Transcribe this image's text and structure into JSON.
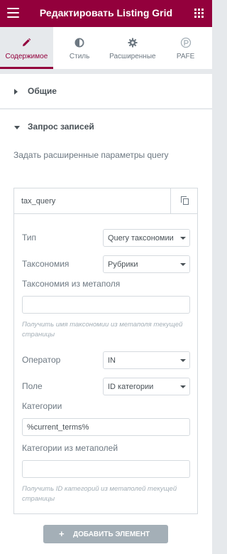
{
  "header": {
    "title": "Редактировать Listing Grid",
    "menu_icon": "hamburger-icon",
    "grid_icon": "apps-grid-icon",
    "bg_color": "#93003c"
  },
  "tabs": [
    {
      "label": "Содержимое",
      "icon": "pencil-icon",
      "active": true
    },
    {
      "label": "Стиль",
      "icon": "half-circle-icon",
      "active": false
    },
    {
      "label": "Расширенные",
      "icon": "gear-icon",
      "active": false
    },
    {
      "label": "PAFE",
      "icon": "pafe-logo-icon",
      "active": false
    }
  ],
  "sections": {
    "general": {
      "label": "Общие",
      "expanded": false
    },
    "query": {
      "label": "Запрос записей",
      "expanded": true
    }
  },
  "query": {
    "description": "Задать расширенные параметры query",
    "item": {
      "title": "tax_query",
      "type": {
        "label": "Тип",
        "value": "Query таксономии"
      },
      "taxonomy": {
        "label": "Таксономия",
        "value": "Рубрики"
      },
      "taxonomy_meta": {
        "label": "Таксономия из метаполя",
        "value": "",
        "hint": "Получить имя таксономии из метаполя текущей страницы"
      },
      "operator": {
        "label": "Оператор",
        "value": "IN"
      },
      "field": {
        "label": "Поле",
        "value": "ID категории"
      },
      "categories": {
        "label": "Категории",
        "value": "%current_terms%"
      },
      "categories_meta": {
        "label": "Категории из метаполей",
        "value": "",
        "hint": "Получить ID категорий из метаполей текущей страницы"
      }
    },
    "add_button": "ДОБАВИТЬ ЭЛЕМЕНТ"
  }
}
